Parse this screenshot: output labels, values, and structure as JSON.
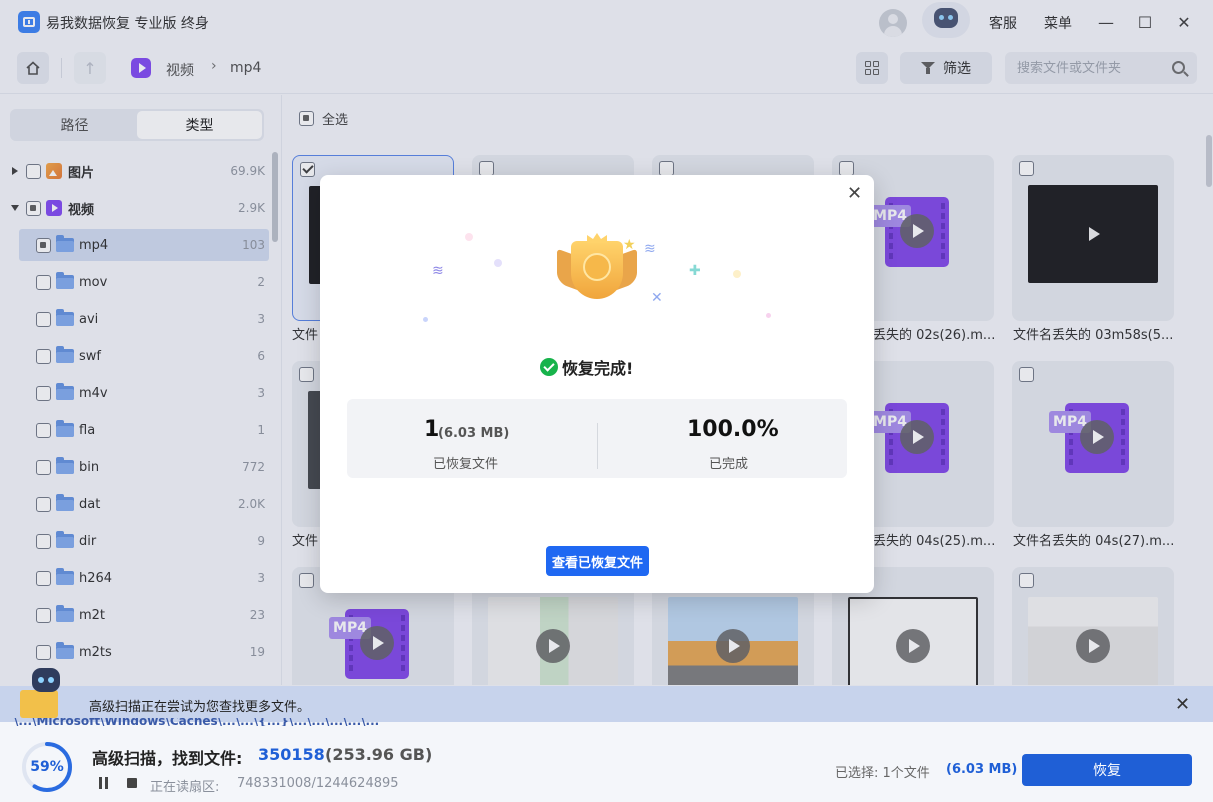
{
  "app": {
    "title": "易我数据恢复 专业版 终身",
    "service_label": "客服",
    "menu_label": "菜单"
  },
  "toolbar": {
    "breadcrumb": [
      "视频",
      "mp4"
    ],
    "filter_label": "筛选",
    "search_placeholder": "搜索文件或文件夹"
  },
  "sidebar": {
    "tabs": [
      "路径",
      "类型"
    ],
    "active_tab": "类型",
    "categories": [
      {
        "label": "图片",
        "count": "69.9K"
      },
      {
        "label": "视频",
        "count": "2.9K"
      }
    ],
    "folders": [
      {
        "label": "mp4",
        "count": "103"
      },
      {
        "label": "mov",
        "count": "2"
      },
      {
        "label": "avi",
        "count": "3"
      },
      {
        "label": "swf",
        "count": "6"
      },
      {
        "label": "m4v",
        "count": "3"
      },
      {
        "label": "fla",
        "count": "1"
      },
      {
        "label": "bin",
        "count": "772"
      },
      {
        "label": "dat",
        "count": "2.0K"
      },
      {
        "label": "dir",
        "count": "9"
      },
      {
        "label": "h264",
        "count": "3"
      },
      {
        "label": "m2t",
        "count": "23"
      },
      {
        "label": "m2ts",
        "count": "19"
      }
    ]
  },
  "main": {
    "select_all_label": "全选",
    "files": [
      {
        "label": "文件"
      },
      {
        "label": "丢失的 02s(26).m..."
      },
      {
        "label": "文件名丢失的 03m58s(5..."
      },
      {
        "label": "文件"
      },
      {
        "label": "丢失的 04s(25).m..."
      },
      {
        "label": "文件名丢失的 04s(27).m..."
      }
    ],
    "mp4_tag": "MP4"
  },
  "scan_strip": {
    "text": "高级扫描正在尝试为您查找更多文件。",
    "path": "\\...\\Microsoft\\Windows\\Caches\\...\\...\\{...}\\...\\...\\...\\...\\..."
  },
  "status": {
    "progress_percent": 59,
    "progress_text": "59%",
    "title": "高级扫描，找到文件:",
    "file_count": "350158",
    "total_size": "(253.96 GB)",
    "reading_label": "正在读扇区:",
    "reading_value": "748331008/1244624895",
    "selected_label": "已选择: 1个文件",
    "selected_size": "(6.03 MB)",
    "recover_label": "恢复"
  },
  "dialog": {
    "done_label": "恢复完成!",
    "recovered_count": "1",
    "recovered_size": "(6.03 MB)",
    "recovered_label": "已恢复文件",
    "completed_value": "100.0%",
    "completed_label": "已完成",
    "view_button": "查看已恢复文件"
  },
  "colors": {
    "accent": "#1f5fd6",
    "video_purple": "#7a3ce8",
    "success_green": "#17b34b"
  }
}
